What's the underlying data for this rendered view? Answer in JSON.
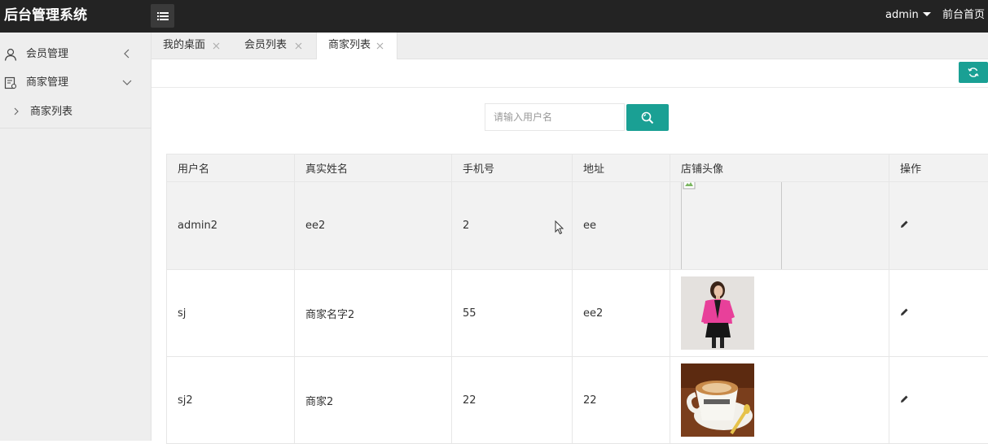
{
  "app": {
    "title": "后台管理系统",
    "user": "admin",
    "front_link": "前台首页"
  },
  "sidebar": {
    "items": [
      {
        "label": "会员管理",
        "icon": "user-icon"
      },
      {
        "label": "商家管理",
        "icon": "shop-icon",
        "expanded": true,
        "children": [
          {
            "label": "商家列表"
          }
        ]
      }
    ]
  },
  "tabs": [
    {
      "label": "我的桌面",
      "active": false
    },
    {
      "label": "会员列表",
      "active": false
    },
    {
      "label": "商家列表",
      "active": true
    }
  ],
  "search": {
    "placeholder": "请输入用户名",
    "value": ""
  },
  "table": {
    "columns": [
      "用户名",
      "真实姓名",
      "手机号",
      "地址",
      "店铺头像",
      "操作"
    ],
    "rows": [
      {
        "username": "admin2",
        "realname": "ee2",
        "phone": "2",
        "address": "ee",
        "avatar": "broken-image",
        "action": "edit-icon"
      },
      {
        "username": "sj",
        "realname": "商家名字2",
        "phone": "55",
        "address": "ee2",
        "avatar": "photo-woman-pink-jacket",
        "action": "edit-icon"
      },
      {
        "username": "sj2",
        "realname": "商家2",
        "phone": "22",
        "address": "22",
        "avatar": "photo-coffee-cup",
        "action": "edit-icon"
      }
    ]
  },
  "colors": {
    "topbar": "#232323",
    "accent": "#1aa094",
    "sidebar": "#eeeeee"
  }
}
